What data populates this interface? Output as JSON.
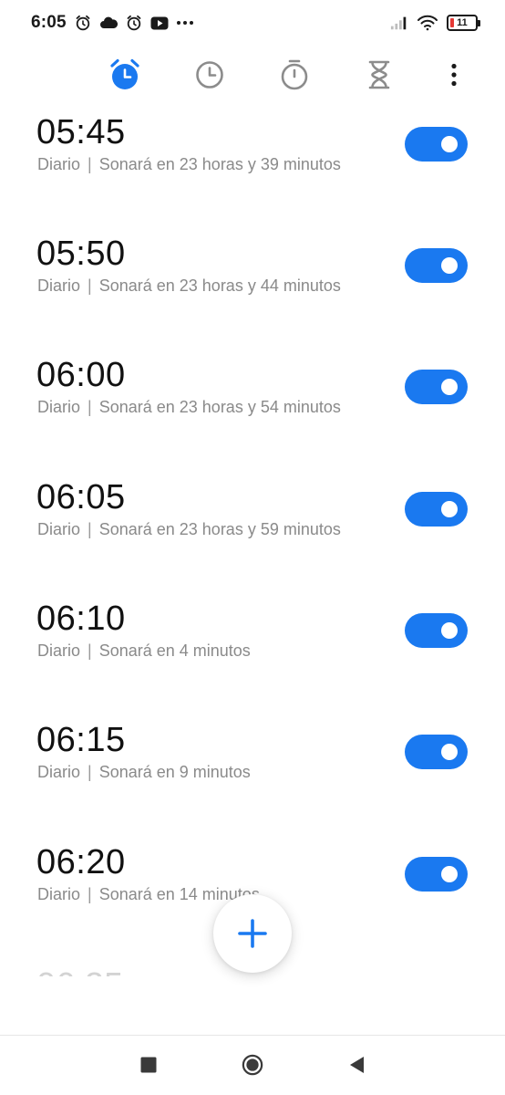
{
  "status_bar": {
    "time": "6:05",
    "battery_level": "11",
    "icons": [
      "alarm-clock-icon",
      "cloud-icon",
      "alarm-icon",
      "youtube-icon",
      "more-dots-icon",
      "signal-icon",
      "wifi-icon",
      "battery-icon"
    ]
  },
  "tabs": [
    {
      "name": "alarm",
      "icon": "alarm-icon",
      "active": true
    },
    {
      "name": "clock",
      "icon": "clock-icon",
      "active": false
    },
    {
      "name": "stopwatch",
      "icon": "stopwatch-icon",
      "active": false
    },
    {
      "name": "timer",
      "icon": "hourglass-icon",
      "active": false
    }
  ],
  "alarms": [
    {
      "time": "05:45",
      "repeat": "Diario",
      "separator": "|",
      "remaining": "Sonará en 23 horas y 39 minutos",
      "enabled": true
    },
    {
      "time": "05:50",
      "repeat": "Diario",
      "separator": "|",
      "remaining": "Sonará en 23 horas y 44 minutos",
      "enabled": true
    },
    {
      "time": "06:00",
      "repeat": "Diario",
      "separator": "|",
      "remaining": "Sonará en 23 horas y 54 minutos",
      "enabled": true
    },
    {
      "time": "06:05",
      "repeat": "Diario",
      "separator": "|",
      "remaining": "Sonará en 23 horas y 59 minutos",
      "enabled": true
    },
    {
      "time": "06:10",
      "repeat": "Diario",
      "separator": "|",
      "remaining": "Sonará en 4 minutos",
      "enabled": true
    },
    {
      "time": "06:15",
      "repeat": "Diario",
      "separator": "|",
      "remaining": "Sonará en 9 minutos",
      "enabled": true
    },
    {
      "time": "06:20",
      "repeat": "Diario",
      "separator": "|",
      "remaining": "Sonará en 14 minutos",
      "enabled": true
    }
  ],
  "partial_alarm_time": "06:25",
  "colors": {
    "accent": "#1a79f0",
    "icon_inactive": "#8c8c8c",
    "subtext": "#8a8a8a"
  },
  "fab": {
    "icon": "plus-icon"
  },
  "nav": {
    "recent": "recent-apps-icon",
    "home": "home-icon",
    "back": "back-icon"
  }
}
